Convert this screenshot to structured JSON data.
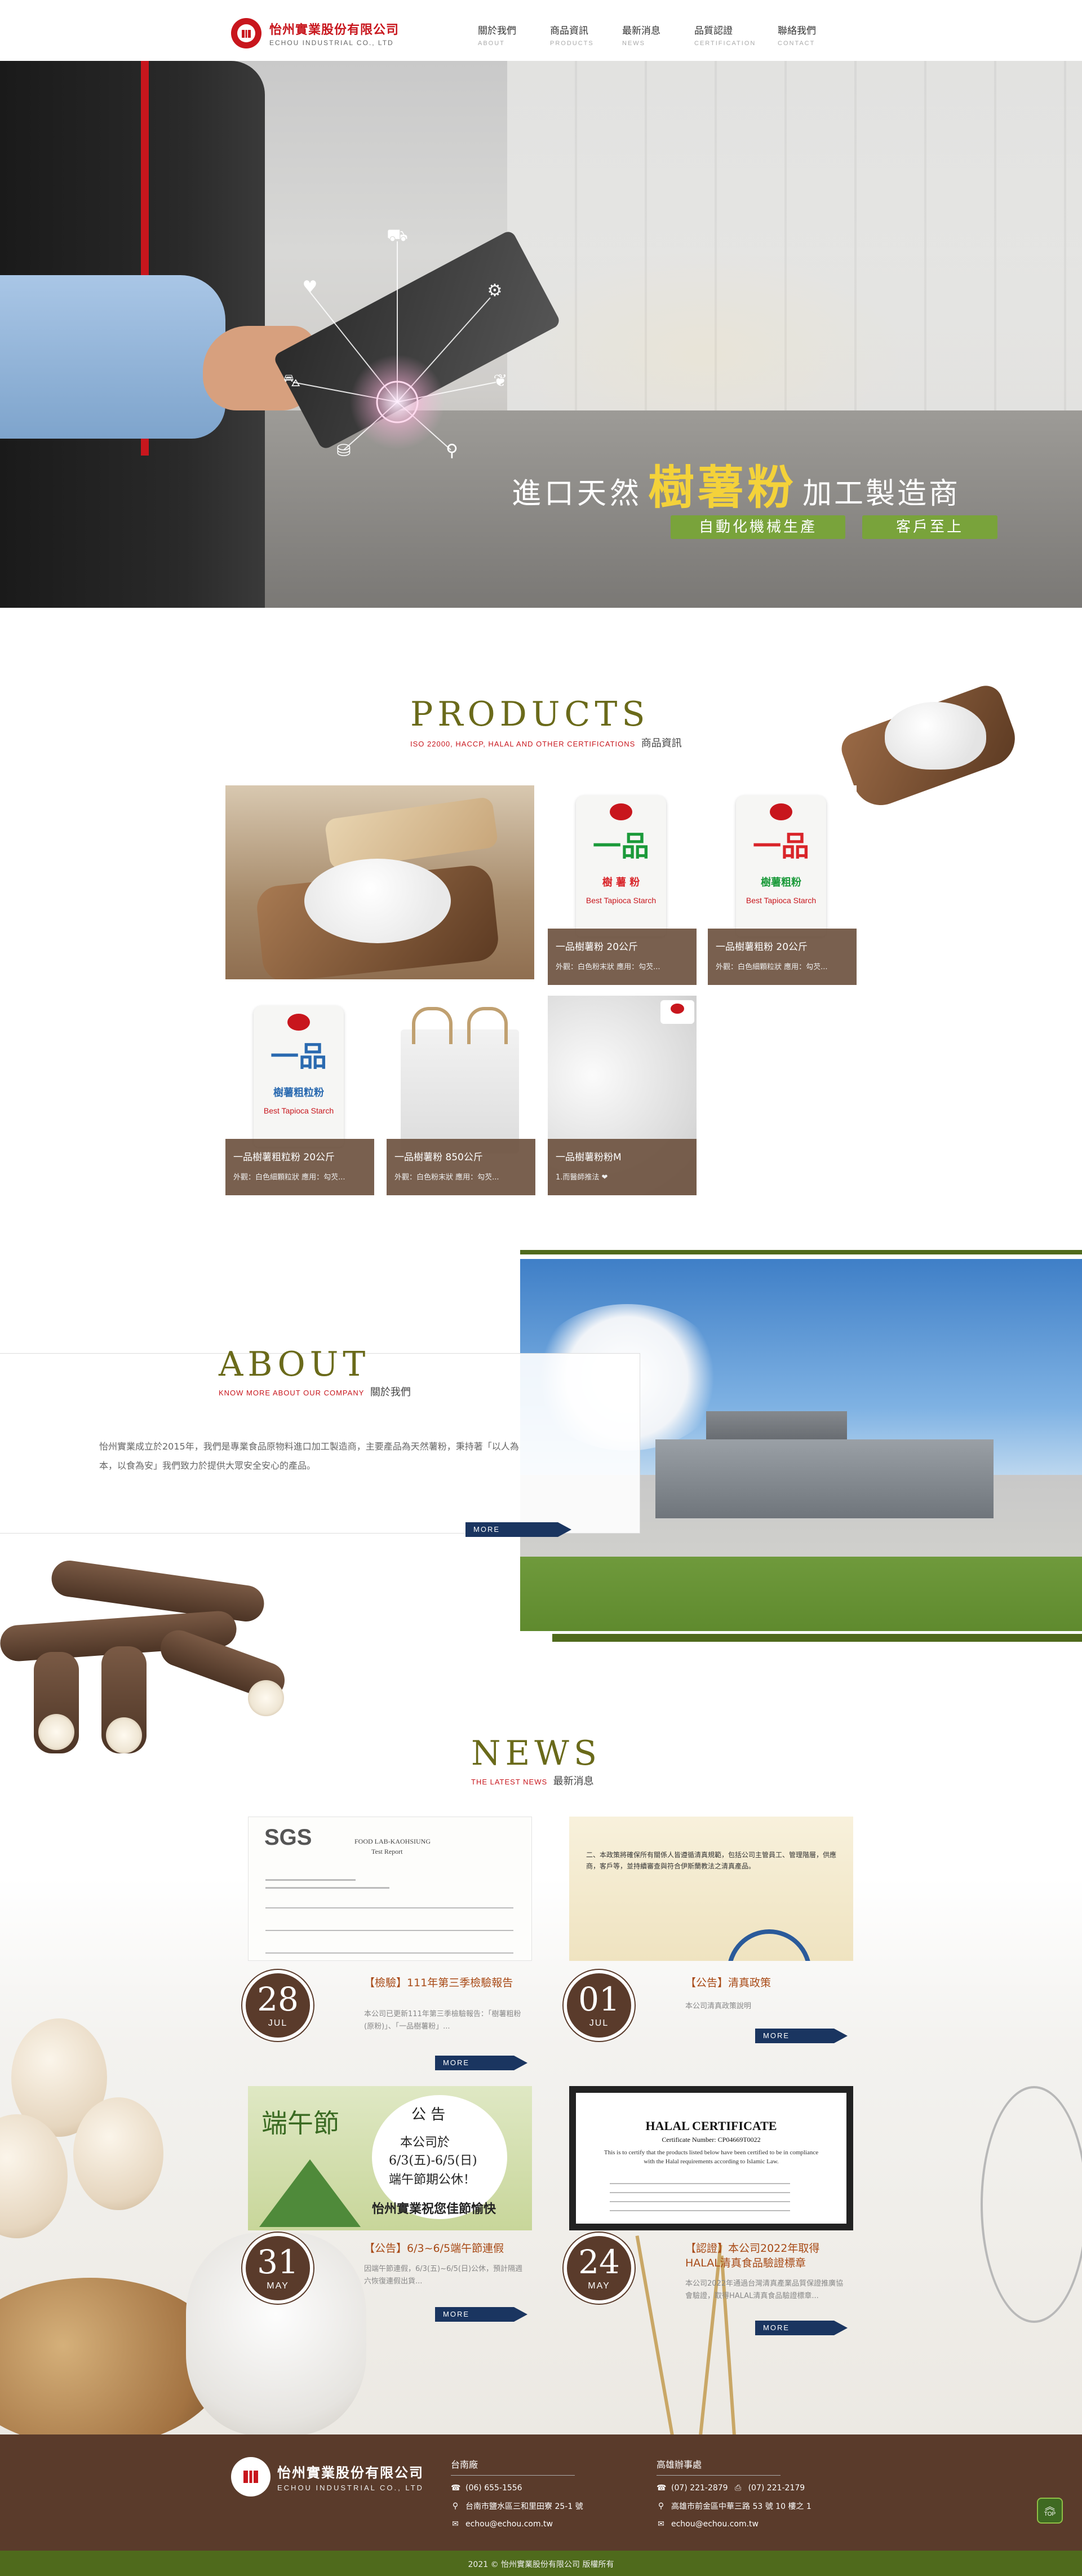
{
  "brand": {
    "name_zh": "怡州實業股份有限公司",
    "name_en": "ECHOU INDUSTRIAL CO., LTD",
    "colors": {
      "red": "#c8161d",
      "olive": "#4f6a1c",
      "brown": "#5a3b2b",
      "navy": "#1a3560",
      "green": "#79a33b"
    }
  },
  "nav": [
    {
      "zh": "關於我們",
      "en": "ABOUT"
    },
    {
      "zh": "商品資訊",
      "en": "PRODUCTS"
    },
    {
      "zh": "最新消息",
      "en": "NEWS"
    },
    {
      "zh": "品質認證",
      "en": "CERTIFICATION"
    },
    {
      "zh": "聯絡我們",
      "en": "CONTACT"
    }
  ],
  "hero": {
    "title_prefix": "進口天然",
    "title_highlight": "樹薯粉",
    "title_suffix": "加工製造商",
    "badges": [
      "自動化機械生產",
      "客戶至上"
    ],
    "slides_total": 3,
    "active_slide": 1
  },
  "products": {
    "heading": "PRODUCTS",
    "sub_en": "ISO 22000, HACCP, HALAL AND OTHER CERTIFICATIONS",
    "sub_zh": "商品資訊",
    "items": [
      {
        "name": "一品樹薯粉 20公斤",
        "desc": "外觀：白色粉末狀 應用：勾芡..."
      },
      {
        "name": "一品樹薯粗粉 20公斤",
        "desc": "外觀：白色細顆粒狀 應用：勾芡..."
      },
      {
        "name": "一品樹薯粗粒粉 20公斤",
        "desc": "外觀：白色細顆粒狀 應用：勾芡..."
      },
      {
        "name": "一品樹薯粉 850公斤",
        "desc": "外觀：白色粉末狀 應用：勾芡..."
      },
      {
        "name": "一品樹薯粉粉M",
        "desc": "1.而醫師推法 ❤"
      }
    ],
    "bag_labels": {
      "big": "一品",
      "sub1": "樹 薯 粉",
      "sub2": "樹薯粗粉",
      "sub3": "樹薯粗粒粉",
      "en1": "Best Tapioca Starch",
      "en2": "Best Tapioca Starch"
    }
  },
  "about": {
    "heading": "ABOUT",
    "sub_en": "KNOW MORE ABOUT OUR COMPANY",
    "sub_zh": "關於我們",
    "text": "怡州實業成立於2015年，我們是專業食品原物料進口加工製造商，主要產品為天然薯粉，秉持著「以人為本，以食為安」我們致力於提供大眾安全安心的產品。",
    "more": "MORE"
  },
  "news": {
    "heading": "NEWS",
    "sub_en": "THE LATEST NEWS",
    "sub_zh": "最新消息",
    "more": "MORE",
    "items": [
      {
        "day": "28",
        "mon": "JUL",
        "title": "【檢驗】111年第三季檢驗報告",
        "summary": "本公司已更新111年第三季檢驗報告：「樹薯粗粉(原粉)」、「一品樹薯粉」..."
      },
      {
        "day": "01",
        "mon": "JUL",
        "title": "【公告】清真政策",
        "summary": "本公司清真政策說明"
      },
      {
        "day": "31",
        "mon": "MAY",
        "title": "【公告】6/3~6/5端午節連假",
        "summary": "因端午節連假，6/3(五)~6/5(日)公休，預計隔週六恢復連假出貨..."
      },
      {
        "day": "24",
        "mon": "MAY",
        "title": "【認證】本公司2022年取得HALAL清真食品驗證標章",
        "summary": "本公司2022年通過台灣清真產業品質保證推廣協會驗證，取得HALAL清真食品驗證標章..."
      }
    ],
    "img_texts": {
      "sgs": "SGS",
      "sgs_sub": "FOOD LAB-KAOHSIUNG",
      "sgs_report": "Test Report",
      "policy_line": "二、本政策將確保所有關係人皆遵循清真規範，包括公司主管員工、管理階層，供應商，客戶等，並持續審查與符合伊斯蘭教法之清真產品。",
      "poster_title": "端午節",
      "poster_notice": "公 告",
      "poster_l1": "本公司於",
      "poster_l2": "6/3(五)-6/5(日)",
      "poster_l3": "端午節期公休！",
      "poster_l4": "怡州實業祝您佳節愉快",
      "halal_title": "HALAL CERTIFICATE",
      "halal_no": "Certificate Number: CP04669T0022",
      "halal_body": "This is to certify that the products listed below have been certified to be in compliance with the Halal requirements according to Islamic Law."
    }
  },
  "footer": {
    "tainan": {
      "title": "台南廠",
      "phone": "(06) 655-1556",
      "address": "台南市鹽水區三和里田寮 25-1 號",
      "email": "echou@echou.com.tw"
    },
    "kaohsiung": {
      "title": "高雄辦事處",
      "phone": "(07) 221-2879",
      "fax": "(07) 221-2179",
      "address": "高雄市前金區中華三路 53 號 10 樓之 1",
      "email": "echou@echou.com.tw"
    },
    "copyright": "2021 © 怡州實業股份有限公司 版權所有",
    "top_label": "TOP"
  }
}
